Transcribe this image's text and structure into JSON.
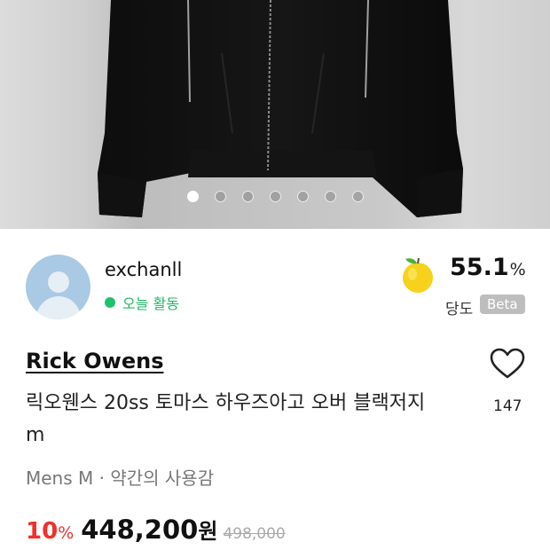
{
  "gallery": {
    "image": "product-photo-black-zip-jacket",
    "slides": 7,
    "active_slide": 1
  },
  "seller": {
    "name": "exchanll",
    "status": "오늘 활동",
    "status_color": "#1fc16b",
    "trust_icon": "apple-icon",
    "trust_value": "55.1",
    "trust_unit": "%",
    "trust_label": "당도",
    "trust_badge": "Beta"
  },
  "product": {
    "brand": "Rick Owens",
    "title": "릭오웬스 20ss 토마스 하우즈아고 오버 블랙저지 m",
    "likes": "147",
    "meta": "Mens M · 약간의 사용감",
    "discount": "10",
    "discount_unit": "%",
    "price": "448,200",
    "price_unit": "원",
    "original_price": "498,000",
    "discount_color": "#f0302a"
  }
}
